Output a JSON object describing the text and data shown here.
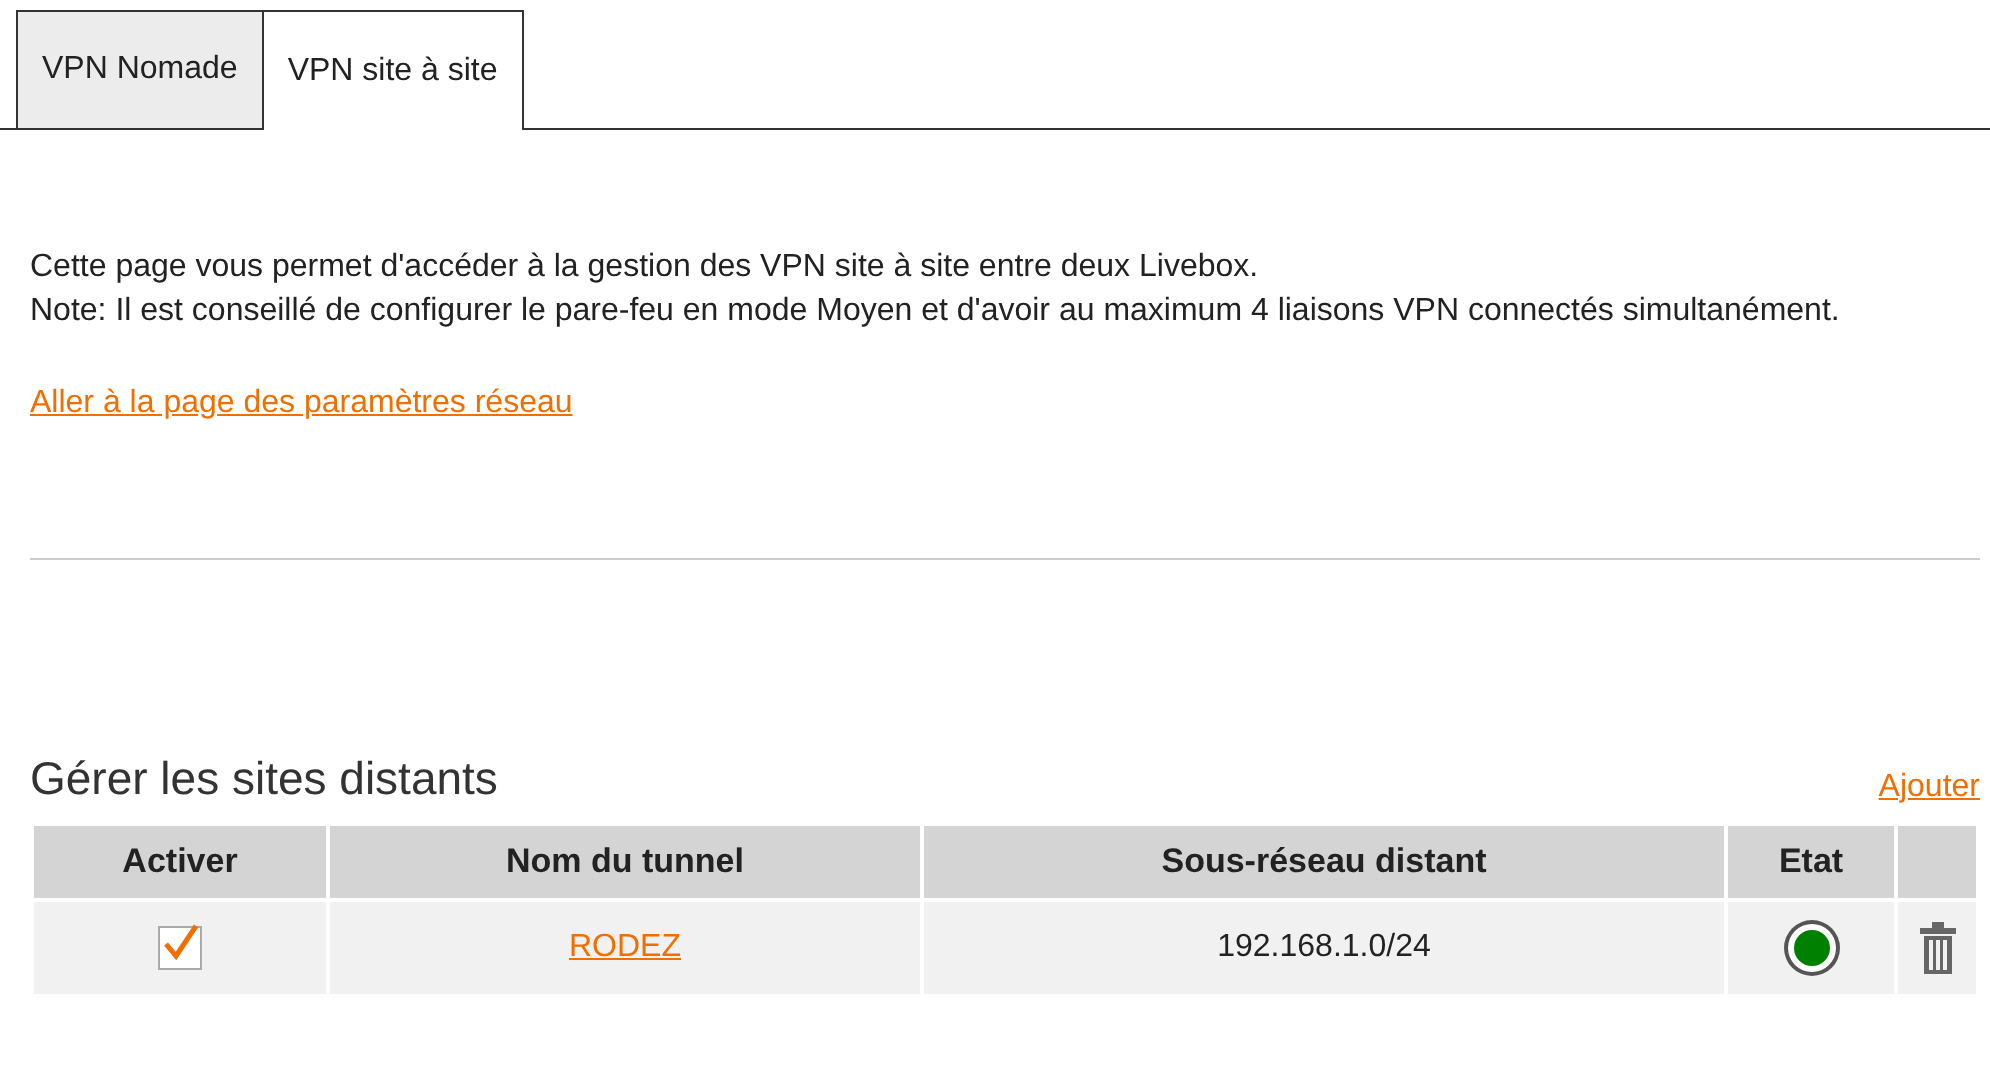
{
  "tabs": [
    {
      "label": "VPN Nomade",
      "selected": false
    },
    {
      "label": "VPN site à site",
      "selected": true
    }
  ],
  "intro": [
    "Cette page vous permet d'accéder à la gestion des VPN site à site entre deux Livebox.",
    "Note: Il est conseillé de configurer le pare-feu en mode Moyen et d'avoir au maximum 4 liaisons VPN connectés simultanément."
  ],
  "network_link": "Aller à la page des paramètres réseau",
  "section": {
    "title": "Gérer les sites distants",
    "add_link": "Ajouter"
  },
  "table": {
    "columns": [
      "Activer",
      "Nom du tunnel",
      "Sous-réseau distant",
      "Etat"
    ],
    "rows": [
      {
        "checked": true,
        "name": "RODEZ",
        "subnet": "192.168.1.0/24",
        "color": "#008000"
      }
    ]
  }
}
